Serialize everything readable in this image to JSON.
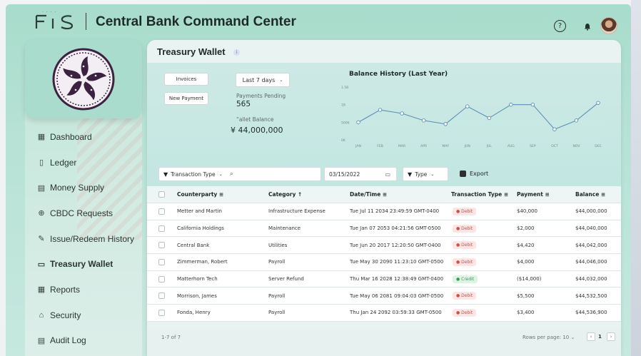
{
  "header": {
    "brand": "FIS",
    "brand_dots": "· · · ·",
    "title": "Central Bank Command Center",
    "help_icon": "?",
    "bell_icon": "🔔"
  },
  "sidebar": {
    "items": [
      {
        "label": "Dashboard",
        "icon": "▦",
        "active": false
      },
      {
        "label": "Ledger",
        "icon": "▯",
        "active": false
      },
      {
        "label": "Money Supply",
        "icon": "▤",
        "active": false
      },
      {
        "label": "CBDC Requests",
        "icon": "⊕",
        "active": false
      },
      {
        "label": "Issue/Redeem History",
        "icon": "✎",
        "active": false
      },
      {
        "label": "Treasury Wallet",
        "icon": "▭",
        "active": true
      },
      {
        "label": "Reports",
        "icon": "▦",
        "active": false
      },
      {
        "label": "Security",
        "icon": "⌂",
        "active": false
      },
      {
        "label": "Audit Log",
        "icon": "▤",
        "active": false
      }
    ]
  },
  "main": {
    "title": "Treasury Wallet",
    "invoices_label": "Invoices",
    "new_payment_label": "New Payment",
    "range_select": "Last 7 days",
    "payments_pending_label": "Payments Pending",
    "payments_pending_value": "565",
    "wallet_balance_label": "“allet Balance",
    "wallet_balance_value": "¥ 44,000,000"
  },
  "chart_data": {
    "type": "line",
    "title": "Balance History (Last Year)",
    "categories": [
      "JAN",
      "FEB",
      "MAR",
      "APR",
      "MAY",
      "JUN",
      "JUL",
      "AUG",
      "SEP",
      "OCT",
      "NOV",
      "DEC"
    ],
    "values": [
      0.5,
      0.85,
      0.75,
      0.55,
      0.45,
      0.95,
      0.62,
      1.0,
      1.0,
      0.3,
      0.55,
      1.05
    ],
    "yticks": [
      "0K",
      "500K",
      "1B",
      "1.5B"
    ],
    "ylim": [
      0,
      1.5
    ],
    "grid": true,
    "color": "#5d8fb7"
  },
  "toolbar": {
    "transaction_type_label": "Transaction Type",
    "date_value": "03/15/2022",
    "type_label": "Type",
    "export_label": "Export"
  },
  "table": {
    "headers": [
      "Counterparty",
      "Category",
      "Date/Time",
      "Transaction Type",
      "Payment",
      "Balance"
    ],
    "rows": [
      {
        "counterparty": "Metter and Martin",
        "category": "Infrastructure Expense",
        "datetime": "Tue Jul 11 2034 23:49:59 GMT-0400",
        "type": "Debit",
        "payment": "$40,000",
        "balance": "$44,000,000"
      },
      {
        "counterparty": "California Holdings",
        "category": "Maintenance",
        "datetime": "Tue Jan 07 2053 04:21:56 GMT-0500",
        "type": "Debit",
        "payment": "$2,000",
        "balance": "$44,040,000"
      },
      {
        "counterparty": "Central Bank",
        "category": "Utilities",
        "datetime": "Tue Jun 20 2017 12:20:50 GMT-0400",
        "type": "Debit",
        "payment": "$4,420",
        "balance": "$44,042,000"
      },
      {
        "counterparty": "Zimmerman, Robert",
        "category": "Payroll",
        "datetime": "Tue May 30 2090 11:23:10 GMT-0500",
        "type": "Debit",
        "payment": "$4,000",
        "balance": "$44,046,000"
      },
      {
        "counterparty": "Matterhorn Tech",
        "category": "Server Refund",
        "datetime": "Thu Mar 16 2028 12:38:49 GMT-0400",
        "type": "Credit",
        "payment": "($14,000)",
        "balance": "$44,032,000"
      },
      {
        "counterparty": "Morrison, James",
        "category": "Payroll",
        "datetime": "Tue May 06 2081 09:04:03 GMT-0500",
        "type": "Debit",
        "payment": "$5,500",
        "balance": "$44,532,500"
      },
      {
        "counterparty": "Fonda, Henry",
        "category": "Payroll",
        "datetime": "Thu Jan 24 2092 03:59:33 GMT-0500",
        "type": "Debit",
        "payment": "$3,400",
        "balance": "$44,536,900"
      }
    ]
  },
  "footer": {
    "range": "1-7 of 7",
    "rows_per_page_label": "Rows per page: 10",
    "page": "1"
  }
}
